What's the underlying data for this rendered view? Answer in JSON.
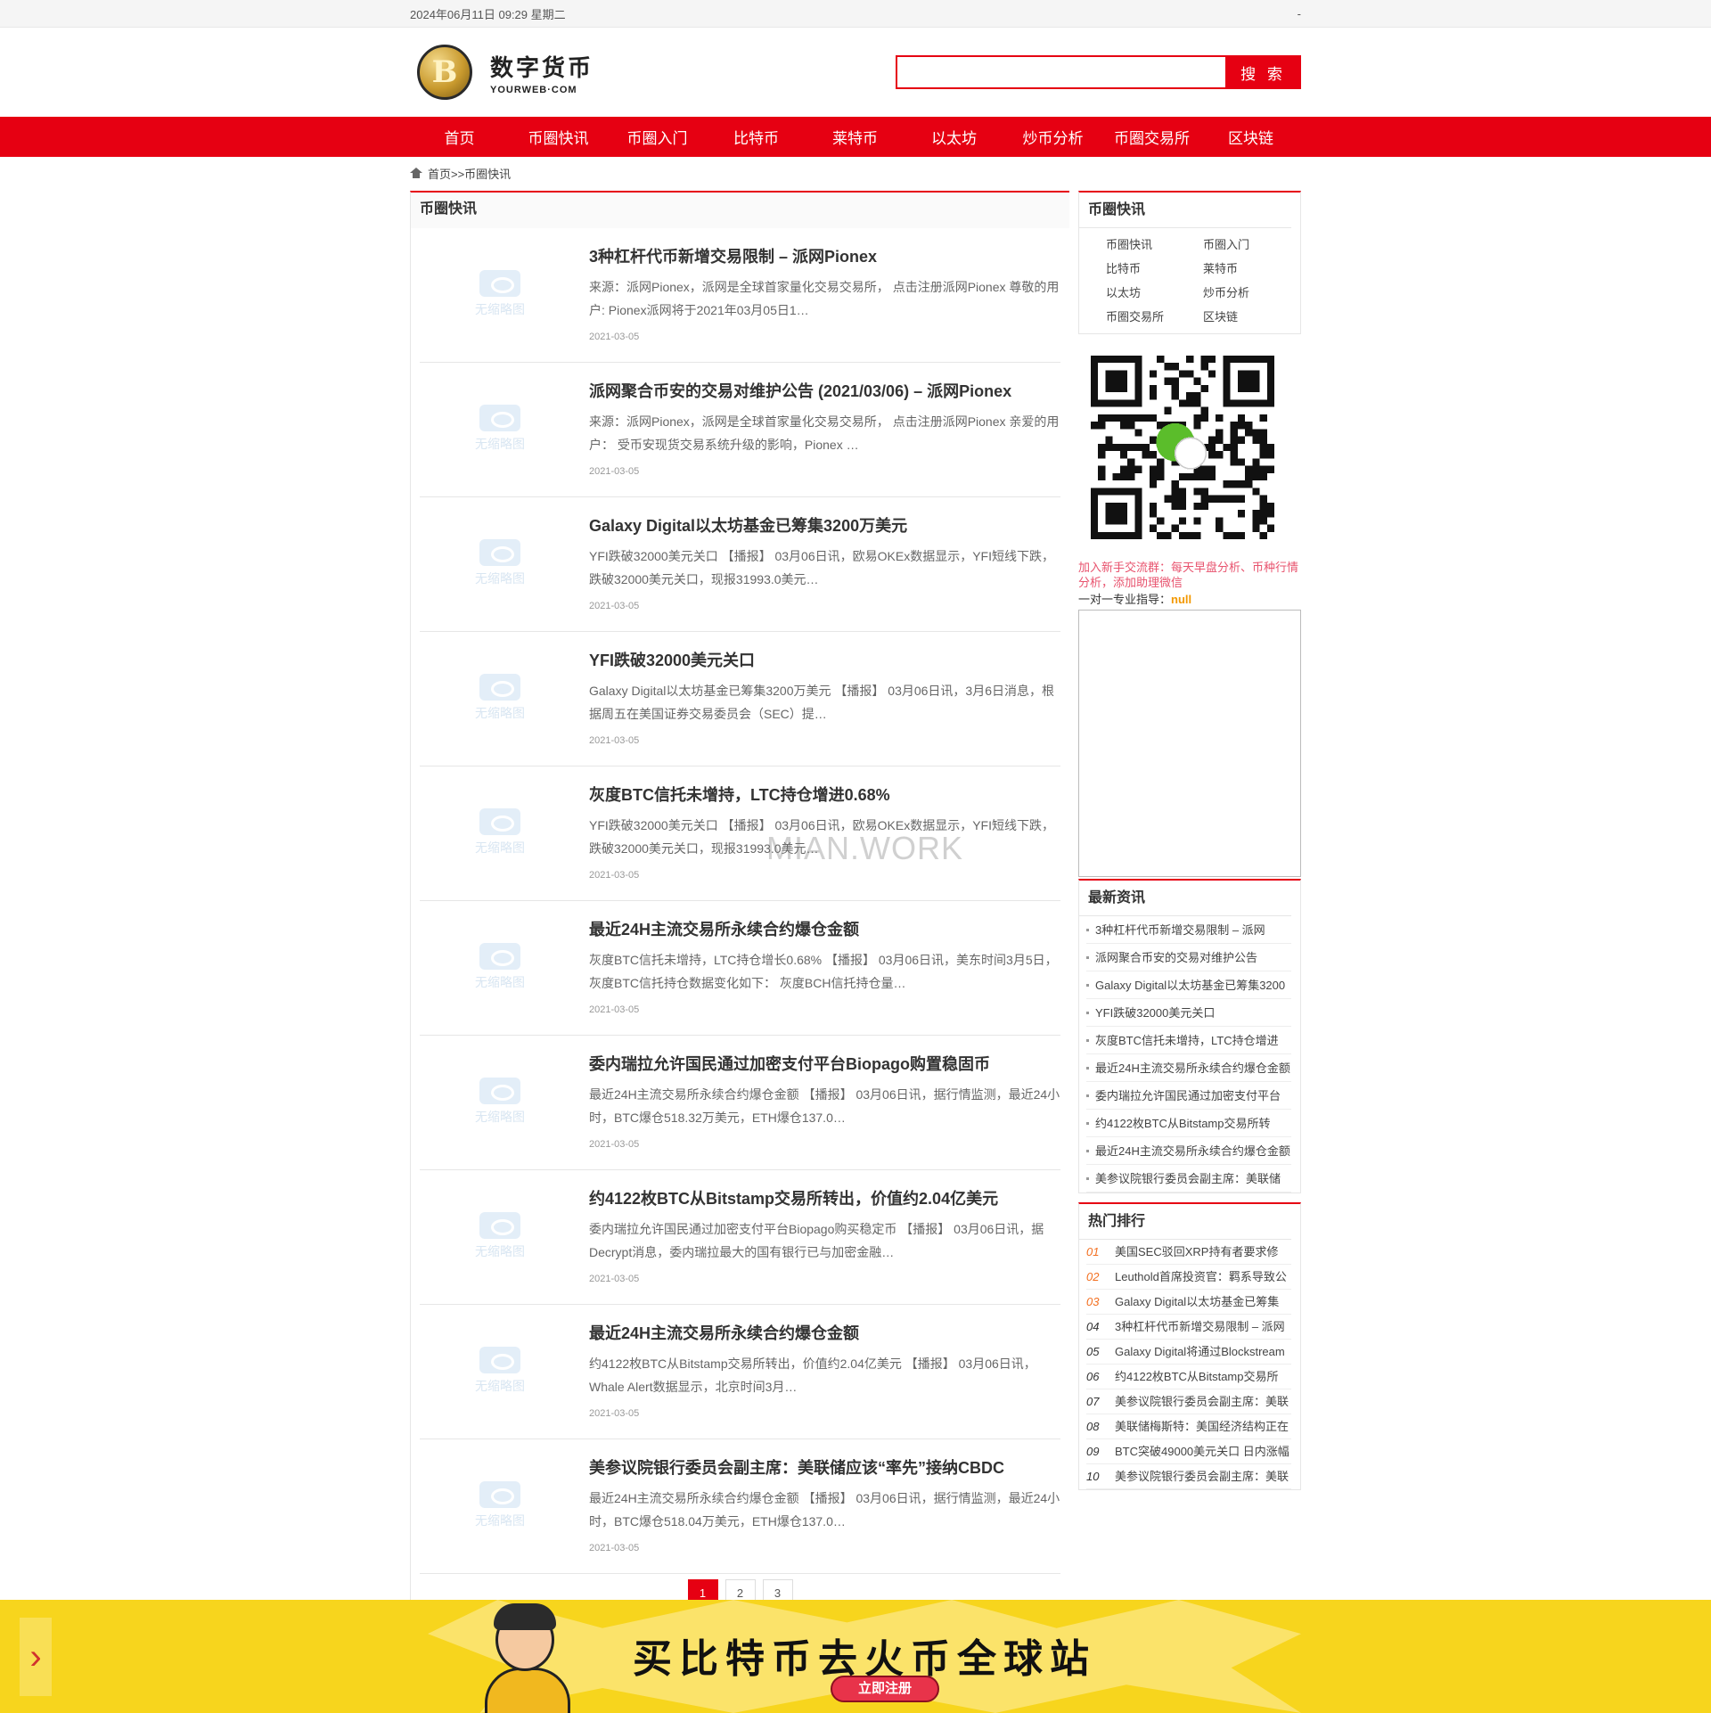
{
  "topbar": {
    "datetime": "2024年06月11日 09:29 星期二",
    "right": "-"
  },
  "logo": {
    "title": "数字货币",
    "subtitle": "YOURWEB·COM",
    "coin_glyph": "B"
  },
  "search": {
    "value": "",
    "placeholder": "",
    "button": "搜 索"
  },
  "nav": [
    "首页",
    "币圈快讯",
    "币圈入门",
    "比特币",
    "莱特币",
    "以太坊",
    "炒币分析",
    "币圈交易所",
    "区块链"
  ],
  "breadcrumb": "首页>>币圈快讯",
  "left": {
    "title": "币圈快讯",
    "thumb_label": "无缩略图",
    "articles": [
      {
        "title": "3种杠杆代币新增交易限制 – 派网Pionex",
        "desc": "来源：派网Pionex，派网是全球首家量化交易交易所， 点击注册派网Pionex 尊敬的用户: Pionex派网将于2021年03月05日1…",
        "date": "2021-03-05"
      },
      {
        "title": "派网聚合币安的交易对维护公告 (2021/03/06) – 派网Pionex",
        "desc": "来源：派网Pionex，派网是全球首家量化交易交易所， 点击注册派网Pionex 亲爱的用户： 受币安现货交易系统升级的影响，Pionex …",
        "date": "2021-03-05"
      },
      {
        "title": "Galaxy Digital以太坊基金已筹集3200万美元",
        "desc": "YFI跌破32000美元关口 【播报】 03月06日讯，欧易OKEx数据显示，YFI短线下跌，跌破32000美元关口，现报31993.0美元…",
        "date": "2021-03-05"
      },
      {
        "title": "YFI跌破32000美元关口",
        "desc": "Galaxy Digital以太坊基金已筹集3200万美元 【播报】 03月06日讯，3月6日消息，根据周五在美国证券交易委员会（SEC）提…",
        "date": "2021-03-05"
      },
      {
        "title": "灰度BTC信托未增持，LTC持仓增进0.68%",
        "desc": "YFI跌破32000美元关口 【播报】 03月06日讯，欧易OKEx数据显示，YFI短线下跌，跌破32000美元关口，现报31993.0美元…",
        "date": "2021-03-05"
      },
      {
        "title": "最近24H主流交易所永续合约爆仓金额",
        "desc": "灰度BTC信托未增持，LTC持仓增长0.68% 【播报】 03月06日讯，美东时间3月5日，灰度BTC信托持仓数据变化如下： 灰度BCH信托持仓量…",
        "date": "2021-03-05"
      },
      {
        "title": "委内瑞拉允许国民通过加密支付平台Biopago购置稳固币",
        "desc": "最近24H主流交易所永续合约爆仓金额 【播报】 03月06日讯，据行情监测，最近24小时，BTC爆仓518.32万美元，ETH爆仓137.0…",
        "date": "2021-03-05"
      },
      {
        "title": "约4122枚BTC从Bitstamp交易所转出，价值约2.04亿美元",
        "desc": "委内瑞拉允许国民通过加密支付平台Biopago购买稳定币 【播报】 03月06日讯，据Decrypt消息，委内瑞拉最大的国有银行已与加密金融…",
        "date": "2021-03-05"
      },
      {
        "title": "最近24H主流交易所永续合约爆仓金额",
        "desc": "约4122枚BTC从Bitstamp交易所转出，价值约2.04亿美元 【播报】 03月06日讯，Whale Alert数据显示，北京时间3月…",
        "date": "2021-03-05"
      },
      {
        "title": "美参议院银行委员会副主席：美联储应该“率先”接纳CBDC",
        "desc": "最近24H主流交易所永续合约爆仓金额 【播报】 03月06日讯，据行情监测，最近24小时，BTC爆仓518.04万美元，ETH爆仓137.0…",
        "date": "2021-03-05"
      }
    ],
    "pager": [
      "1",
      "2",
      "3"
    ]
  },
  "watermark": "MIAN.WORK",
  "right": {
    "cat_title": "币圈快讯",
    "categories": [
      "币圈快讯",
      "币圈入门",
      "比特币",
      "莱特币",
      "以太坊",
      "炒币分析",
      "币圈交易所",
      "区块链"
    ],
    "qr_note": "加入新手交流群：每天早盘分析、币种行情分析，添加助理微信",
    "qr_guide_label": "一对一专业指导：",
    "qr_guide_value": "null",
    "latest_title": "最新资讯",
    "latest": [
      "3种杠杆代币新增交易限制 – 派网",
      "派网聚合币安的交易对维护公告",
      "Galaxy Digital以太坊基金已筹集3200",
      "YFI跌破32000美元关口",
      "灰度BTC信托未增持，LTC持仓增进",
      "最近24H主流交易所永续合约爆仓金额",
      "委内瑞拉允许国民通过加密支付平台",
      "约4122枚BTC从Bitstamp交易所转",
      "最近24H主流交易所永续合约爆仓金额",
      "美参议院银行委员会副主席：美联储"
    ],
    "hot_title": "热门排行",
    "hot": [
      {
        "n": "01",
        "t": "美国SEC驳回XRP持有者要求修"
      },
      {
        "n": "02",
        "t": "Leuthold首席投资官：羁系导致公"
      },
      {
        "n": "03",
        "t": "Galaxy Digital以太坊基金已筹集"
      },
      {
        "n": "04",
        "t": "3种杠杆代币新增交易限制 – 派网"
      },
      {
        "n": "05",
        "t": "Galaxy Digital将通过Blockstream"
      },
      {
        "n": "06",
        "t": "约4122枚BTC从Bitstamp交易所"
      },
      {
        "n": "07",
        "t": "美参议院银行委员会副主席：美联"
      },
      {
        "n": "08",
        "t": "美联储梅斯特：美国经济结构正在"
      },
      {
        "n": "09",
        "t": "BTC突破49000美元关口 日内涨幅"
      },
      {
        "n": "10",
        "t": "美参议院银行委员会副主席：美联"
      }
    ]
  },
  "banner": {
    "slogan": "买比特币去火币全球站",
    "button": "立即注册",
    "arrow": "›"
  },
  "colors": {
    "brand_red": "#e60012",
    "banner_yellow": "#f7d51d",
    "hot_top": "#f37021"
  }
}
